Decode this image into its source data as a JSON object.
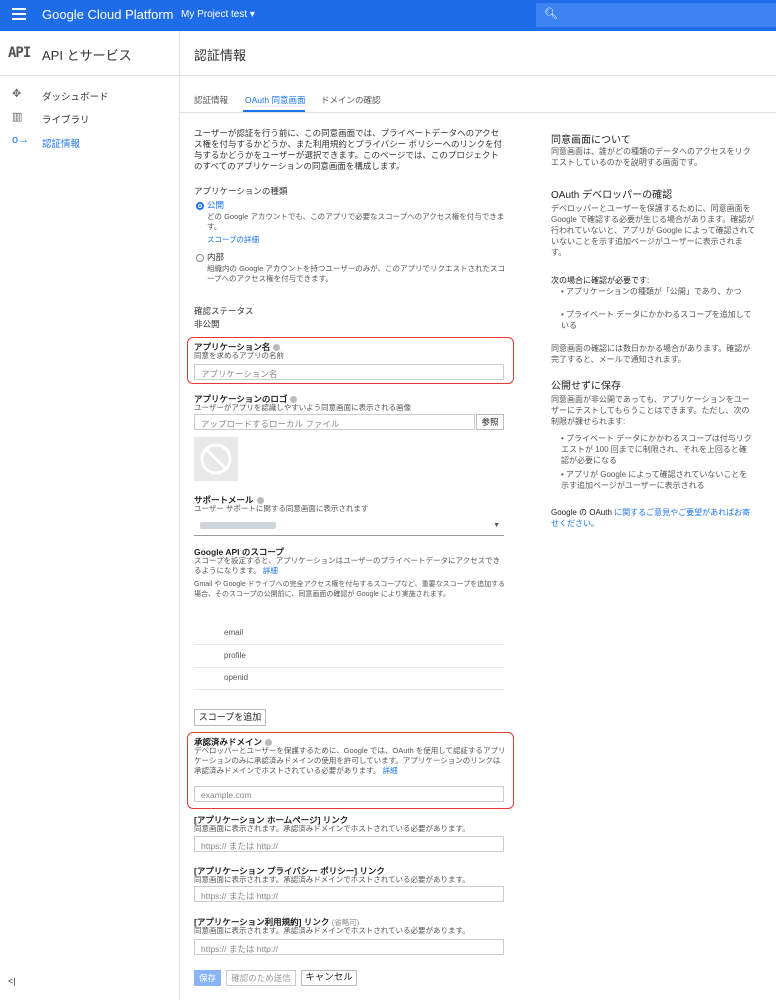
{
  "topbar": {
    "brand": "Google Cloud Platform",
    "project": "My Project test ▾",
    "search_icon": "search-icon"
  },
  "sidebar": {
    "api_logo": "API",
    "title": "API とサービス",
    "items": [
      {
        "label": "ダッシュボード",
        "icon": "✥"
      },
      {
        "label": "ライブラリ",
        "icon": "▥"
      },
      {
        "label": "認証情報",
        "icon": "o→"
      }
    ],
    "collapse": "<|"
  },
  "page": {
    "title": "認証情報"
  },
  "tabs": [
    "認証情報",
    "OAuth 同意画面",
    "ドメインの確認"
  ],
  "intro": "ユーザーが認証を行う前に、この同意画面では、プライベートデータへのアクセス権を付与するかどうか、また利用規約とプライバシー ポリシーへのリンクを付与するかどうかをユーザーが選択できます。このページでは、このプロジェクトのすべてのアプリケーションの同意画面を構成します。",
  "app_type": {
    "label": "アプリケーションの種類",
    "public": {
      "label": "公開",
      "desc": "どの Google アカウントでも、このアプリで必要なスコープへのアクセス権を付与できます。",
      "link": "スコープの詳細"
    },
    "internal": {
      "label": "内部",
      "desc": "組織内の Google アカウントを持つユーザーのみが、このアプリでリクエストされたスコープへのアクセス権を付与できます。"
    }
  },
  "verification": {
    "label": "確認ステータス",
    "value": "非公開"
  },
  "app_name": {
    "label": "アプリケーション名",
    "desc": "同意を求めるアプリの名前",
    "placeholder": "アプリケーション名"
  },
  "app_logo": {
    "label": "アプリケーションのロゴ",
    "desc": "ユーザーがアプリを認識しやすいよう同意画面に表示される画像",
    "placeholder": "アップロードするローカル ファイル",
    "browse": "参照"
  },
  "support_email": {
    "label": "サポートメール",
    "desc": "ユーザー サポートに関する同意画面に表示されます"
  },
  "scopes": {
    "label": "Google API のスコープ",
    "desc": "スコープを設定すると、アプリケーションはユーザーのプライベートデータにアクセスできるようになります。",
    "desc_link": "詳細",
    "note": "Gmail や Google ドライブへの完全アクセス権を付与するスコープなど、重要なスコープを追加する場合、そのスコープの公開前に、同意画面の確認が Google により実施されます。",
    "items": [
      "email",
      "profile",
      "openid"
    ],
    "add_button": "スコープを追加"
  },
  "domains": {
    "label": "承認済みドメイン",
    "desc": "デベロッパーとユーザーを保護するために、Google では、OAuth を使用して認証するアプリケーションのみに承認済みドメインの使用を許可しています。アプリケーションのリンクは承認済みドメインでホストされている必要があります。",
    "desc_link": "詳細",
    "placeholder": "example.com"
  },
  "homepage": {
    "label": "[アプリケーション ホームページ] リンク",
    "desc": "同意画面に表示されます。承認済みドメインでホストされている必要があります。",
    "placeholder": "https:// または http://"
  },
  "privacy": {
    "label": "[アプリケーション プライバシー ポリシー] リンク",
    "desc": "同意画面に表示されます。承認済みドメインでホストされている必要があります。",
    "placeholder": "https:// または http://"
  },
  "tos": {
    "label": "[アプリケーション利用規約] リンク",
    "optional": "(省略可)",
    "desc": "同意画面に表示されます。承認済みドメインでホストされている必要があります。",
    "placeholder": "https:// または http://"
  },
  "footer": {
    "save": "保存",
    "submit": "確認のため送信",
    "cancel": "キャンセル"
  },
  "right": {
    "about_title": "同意画面について",
    "about_text": "同意画面は、誰がどの種類のデータへのアクセスをリクエストしているのかを説明する画面です。",
    "verify_title": "OAuth デベロッパーの確認",
    "verify_text": "デベロッパーとユーザーを保護するために、同意画面を Google で確認する必要が生じる場合があります。確認が行われていないと、アプリが Google によって確認されていないことを示す追加ページがユーザーに表示されます。",
    "need_title": "次の場合に確認が必要です:",
    "need_items": [
      "アプリケーションの種類が「公開」であり、かつ",
      "プライベート データにかかわるスコープを追加している"
    ],
    "days_text": "同意画面の確認には数日かかる場合があります。確認が完了すると、メールで通知されます。",
    "save_title": "公開せずに保存",
    "save_text": "同意画面が非公開であっても、アプリケーションをユーザーにテストしてもらうことはできます。ただし、次の制限が課せられます:",
    "limits": [
      "プライベート データにかかわるスコープは付与リクエストが 100 回までに制限され、それを上回ると確認が必要になる",
      "アプリが Google によって確認されていないことを示す追加ページがユーザーに表示される"
    ],
    "feedback_prefix": "Google の OAuth ",
    "feedback_link": "に関するご意見やご要望があればお寄せください。"
  }
}
